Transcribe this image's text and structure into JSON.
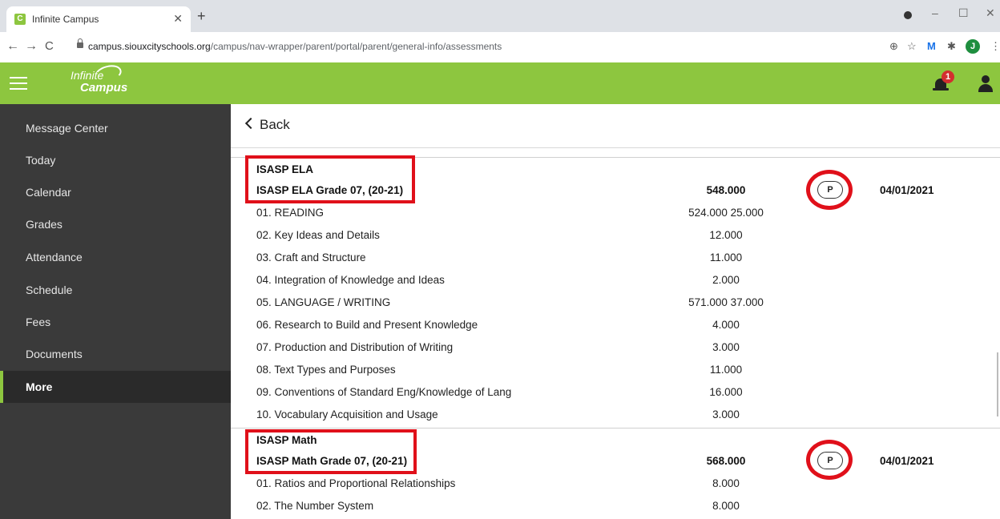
{
  "browser": {
    "tab_title": "Infinite Campus",
    "tab_favicon": "C",
    "url_host": "campus.siouxcityschools.org",
    "url_path": "/campus/nav-wrapper/parent/portal/parent/general-info/assessments",
    "profile_initial": "J"
  },
  "header": {
    "logo_line1": "Infinite",
    "logo_line2": "Campus",
    "notification_count": "1"
  },
  "sidebar": {
    "items": [
      {
        "label": "Message Center"
      },
      {
        "label": "Today"
      },
      {
        "label": "Calendar"
      },
      {
        "label": "Grades"
      },
      {
        "label": "Attendance"
      },
      {
        "label": "Schedule"
      },
      {
        "label": "Fees"
      },
      {
        "label": "Documents"
      },
      {
        "label": "More"
      }
    ],
    "active": "More"
  },
  "main": {
    "back_label": "Back",
    "ela": {
      "group_title": "ISASP ELA",
      "test_name": "ISASP ELA Grade 07, (20-21)",
      "score": "548.000",
      "badge": "P",
      "date": "04/01/2021",
      "rows": [
        {
          "name": "01. READING",
          "score": "524.000 25.000"
        },
        {
          "name": "02. Key Ideas and Details",
          "score": "12.000"
        },
        {
          "name": "03. Craft and Structure",
          "score": "11.000"
        },
        {
          "name": "04. Integration of Knowledge and Ideas",
          "score": "2.000"
        },
        {
          "name": "05. LANGUAGE / WRITING",
          "score": "571.000 37.000"
        },
        {
          "name": "06. Research to Build and Present Knowledge",
          "score": "4.000"
        },
        {
          "name": "07. Production and Distribution of Writing",
          "score": "3.000"
        },
        {
          "name": "08. Text Types and Purposes",
          "score": "11.000"
        },
        {
          "name": "09. Conventions of Standard Eng/Knowledge of Lang",
          "score": "16.000"
        },
        {
          "name": "10. Vocabulary Acquisition and Usage",
          "score": "3.000"
        }
      ]
    },
    "math": {
      "group_title": "ISASP Math",
      "test_name": "ISASP Math Grade 07, (20-21)",
      "score": "568.000",
      "badge": "P",
      "date": "04/01/2021",
      "rows": [
        {
          "name": "01. Ratios and Proportional Relationships",
          "score": "8.000"
        },
        {
          "name": "02. The Number System",
          "score": "8.000"
        }
      ]
    }
  },
  "colors": {
    "brand_green": "#8dc63f",
    "sidebar_bg": "#3a3a3a",
    "annotation_red": "#e0101a"
  }
}
